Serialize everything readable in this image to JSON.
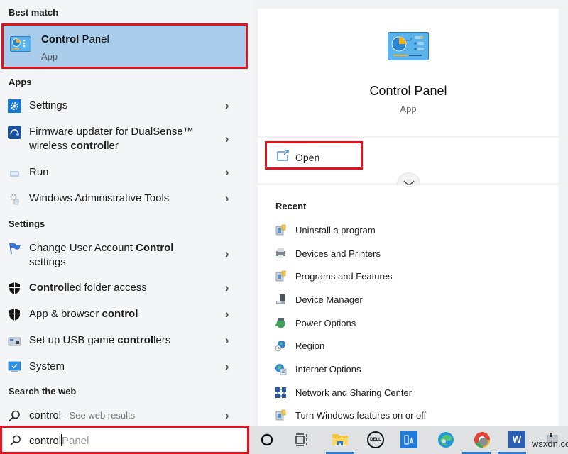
{
  "left_panel": {
    "best_match_heading": "Best match",
    "best_match": {
      "title_bold": "Control",
      "title_rest": " Panel",
      "subtitle": "App",
      "icon": "control-panel-icon"
    },
    "apps_heading": "Apps",
    "apps": [
      {
        "pre": "Settings",
        "bold": "",
        "post": "",
        "line2": "",
        "icon": "settings-gear-icon"
      },
      {
        "pre": "Firmware updater for DualSense™",
        "bold": "",
        "post": "",
        "line2_pre": "wireless ",
        "line2_bold": "control",
        "line2_post": "ler",
        "icon": "firmware-updater-icon"
      },
      {
        "pre": "Run",
        "bold": "",
        "post": "",
        "icon": "run-icon"
      },
      {
        "pre": "Windows Administrative Tools",
        "bold": "",
        "post": "",
        "icon": "admin-tools-icon"
      }
    ],
    "settings_heading": "Settings",
    "settings": [
      {
        "pre": "Change User Account ",
        "bold": "Control",
        "post": "",
        "line2": "settings",
        "icon": "uac-flag-icon"
      },
      {
        "pre": "",
        "bold": "Control",
        "post": "led folder access",
        "icon": "shield-icon"
      },
      {
        "pre": "App & browser ",
        "bold": "control",
        "post": "",
        "icon": "shield-icon"
      },
      {
        "pre": "Set up USB game ",
        "bold": "control",
        "post": "lers",
        "icon": "game-controller-icon"
      },
      {
        "pre": "System",
        "bold": "",
        "post": "",
        "icon": "system-monitor-icon"
      }
    ],
    "web_heading": "Search the web",
    "web_result": {
      "query": "control",
      "suffix": " - See web results",
      "icon": "search-icon"
    }
  },
  "search": {
    "typed": "control",
    "suggestion": "Panel",
    "icon": "search-icon"
  },
  "detail": {
    "title": "Control Panel",
    "subtitle": "App",
    "open_label": "Open",
    "recent_heading": "Recent",
    "recent": [
      {
        "label": "Uninstall a program",
        "icon": "programs-icon"
      },
      {
        "label": "Devices and Printers",
        "icon": "printer-icon"
      },
      {
        "label": "Programs and Features",
        "icon": "programs-icon"
      },
      {
        "label": "Device Manager",
        "icon": "device-manager-icon"
      },
      {
        "label": "Power Options",
        "icon": "power-options-icon"
      },
      {
        "label": "Region",
        "icon": "region-globe-icon"
      },
      {
        "label": "Internet Options",
        "icon": "internet-options-icon"
      },
      {
        "label": "Network and Sharing Center",
        "icon": "network-icon"
      },
      {
        "label": "Turn Windows features on or off",
        "icon": "windows-features-icon"
      }
    ]
  },
  "taskbar": {
    "items": [
      "cortana-icon",
      "task-view-icon",
      "file-explorer-icon",
      "dell-icon",
      "app-icon",
      "edge-icon",
      "chrome-icon",
      "word-icon",
      "tray-icon"
    ],
    "dell_text": "DELL",
    "word_letter": "W",
    "watermark": "wsxdn.com"
  },
  "colors": {
    "highlight_border": "#e0141e",
    "selection_bg": "#a9cdea",
    "accent": "#2b7bd6"
  }
}
